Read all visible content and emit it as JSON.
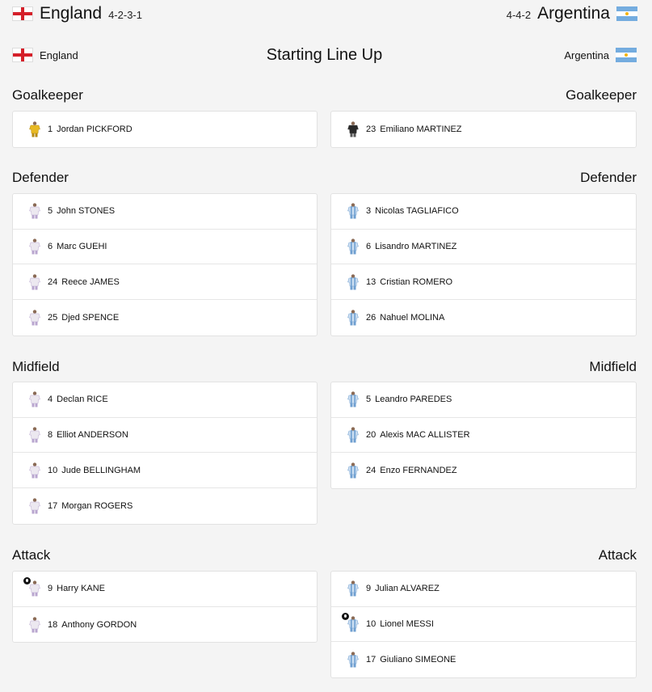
{
  "header": {
    "home": {
      "name": "England",
      "formation": "4-2-3-1"
    },
    "away": {
      "name": "Argentina",
      "formation": "4-4-2"
    }
  },
  "lineup": {
    "title": "Starting Line Up",
    "home_label": "England",
    "away_label": "Argentina"
  },
  "sections": {
    "goalkeeper": "Goalkeeper",
    "defender": "Defender",
    "midfield": "Midfield",
    "attack": "Attack"
  },
  "england": {
    "goalkeeper": [
      {
        "number": "1",
        "name": "Jordan PICKFORD"
      }
    ],
    "defender": [
      {
        "number": "5",
        "name": "John STONES"
      },
      {
        "number": "6",
        "name": "Marc GUEHI"
      },
      {
        "number": "24",
        "name": "Reece JAMES"
      },
      {
        "number": "25",
        "name": "Djed SPENCE"
      }
    ],
    "midfield": [
      {
        "number": "4",
        "name": "Declan RICE"
      },
      {
        "number": "8",
        "name": "Elliot ANDERSON"
      },
      {
        "number": "10",
        "name": "Jude BELLINGHAM"
      },
      {
        "number": "17",
        "name": "Morgan ROGERS"
      }
    ],
    "attack": [
      {
        "number": "9",
        "name": "Harry KANE"
      },
      {
        "number": "18",
        "name": "Anthony GORDON"
      }
    ]
  },
  "argentina": {
    "goalkeeper": [
      {
        "number": "23",
        "name": "Emiliano MARTINEZ"
      }
    ],
    "defender": [
      {
        "number": "3",
        "name": "Nicolas TAGLIAFICO"
      },
      {
        "number": "6",
        "name": "Lisandro MARTINEZ"
      },
      {
        "number": "13",
        "name": "Cristian ROMERO"
      },
      {
        "number": "26",
        "name": "Nahuel MOLINA"
      }
    ],
    "midfield": [
      {
        "number": "5",
        "name": "Leandro PAREDES"
      },
      {
        "number": "20",
        "name": "Alexis MAC ALLISTER"
      },
      {
        "number": "24",
        "name": "Enzo FERNANDEZ"
      }
    ],
    "attack": [
      {
        "number": "9",
        "name": "Julian ALVAREZ"
      },
      {
        "number": "10",
        "name": "Lionel MESSI"
      },
      {
        "number": "17",
        "name": "Giuliano SIMEONE"
      }
    ]
  },
  "colors": {
    "england_kit": "#ece8f0",
    "england_gk_kit": "#e8b923",
    "argentina_kit": "#c9dcf0",
    "argentina_stripe": "#6f9fd0",
    "argentina_gk_kit": "#2a2a2a",
    "captain_badge": "#111111"
  },
  "icons": {
    "home_flag": "england-flag-icon",
    "away_flag": "argentina-flag-icon",
    "kit": "shirt-kit-icon",
    "captain": "captain-armband-icon"
  }
}
